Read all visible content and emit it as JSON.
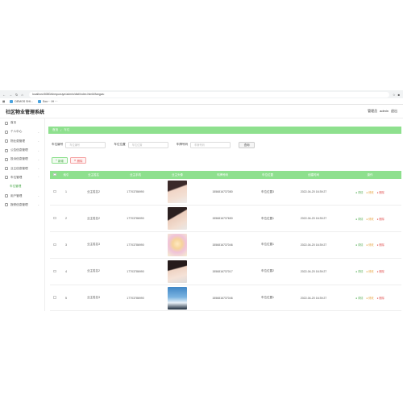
{
  "browser": {
    "url": "localhost:8080/shequwuye/admin/dist/index.html#/fangwu",
    "bookmarks": [
      "DEMOS  SHI...",
      "Sou··· IH ···"
    ]
  },
  "app": {
    "title": "社区物业管理系统",
    "user_role": "管理员",
    "user_name": "admin",
    "logout": "退出"
  },
  "sidebar": {
    "items": [
      {
        "label": "首页",
        "icon": "home-icon"
      },
      {
        "label": "个人中心",
        "icon": "user-icon"
      },
      {
        "label": "物业费管理",
        "icon": "fee-icon"
      },
      {
        "label": "公告信息管理",
        "icon": "notice-icon"
      },
      {
        "label": "投诉信息管理",
        "icon": "complaint-icon"
      },
      {
        "label": "业主信息管理",
        "icon": "owner-icon"
      },
      {
        "label": "车位管理",
        "icon": "car-icon"
      },
      {
        "label": "车位管理",
        "icon": "",
        "sub": true
      },
      {
        "label": "用户管理",
        "icon": "users-icon"
      },
      {
        "label": "报修信息管理",
        "icon": "repair-icon"
      }
    ]
  },
  "breadcrumb": {
    "root": "首页",
    "current": "车位"
  },
  "search": {
    "fields": [
      {
        "label": "车位编号",
        "placeholder": "车位编号"
      },
      {
        "label": "车位位置",
        "placeholder": "车位位置"
      },
      {
        "label": "车牌号码",
        "placeholder": "车牌号码"
      }
    ],
    "button": "查询"
  },
  "actions": {
    "add": "新增",
    "delete": "删除"
  },
  "table": {
    "headers": [
      "索引",
      "业主姓名",
      "业主手机",
      "业主头像",
      "车牌号码",
      "车位位置",
      "创建时间",
      "操作"
    ],
    "ops": {
      "view": "详情",
      "edit": "修改",
      "delete": "删除"
    },
    "rows": [
      {
        "index": "1",
        "name": "业主姓名2",
        "phone": "17703786990",
        "avatar": "t1",
        "plate": "1556816737080",
        "location": "车位位置3",
        "created": "2022-04-20 16:39:27"
      },
      {
        "index": "2",
        "name": "业主姓名2",
        "phone": "17703786990",
        "avatar": "t2",
        "plate": "1556816737650",
        "location": "车位位置1",
        "created": "2022-04-20 16:39:27"
      },
      {
        "index": "3",
        "name": "业主姓名3",
        "phone": "17703786990",
        "avatar": "t3",
        "plate": "1556816737046",
        "location": "车位位置1",
        "created": "2022-04-20 16:39:27"
      },
      {
        "index": "4",
        "name": "业主姓名2",
        "phone": "17703786990",
        "avatar": "t4",
        "plate": "1556816737017",
        "location": "车位位置2",
        "created": "2022-04-20 16:39:27"
      },
      {
        "index": "5",
        "name": "业主姓名3",
        "phone": "17703786990",
        "avatar": "t5",
        "plate": "1556816737046",
        "location": "车位位置1",
        "created": "2022-04-20 16:39:27"
      }
    ]
  },
  "colors": {
    "accent": "#8ee08e",
    "accent_text": "#4aa84a",
    "danger": "#e25555",
    "warning": "#e6a23c"
  }
}
